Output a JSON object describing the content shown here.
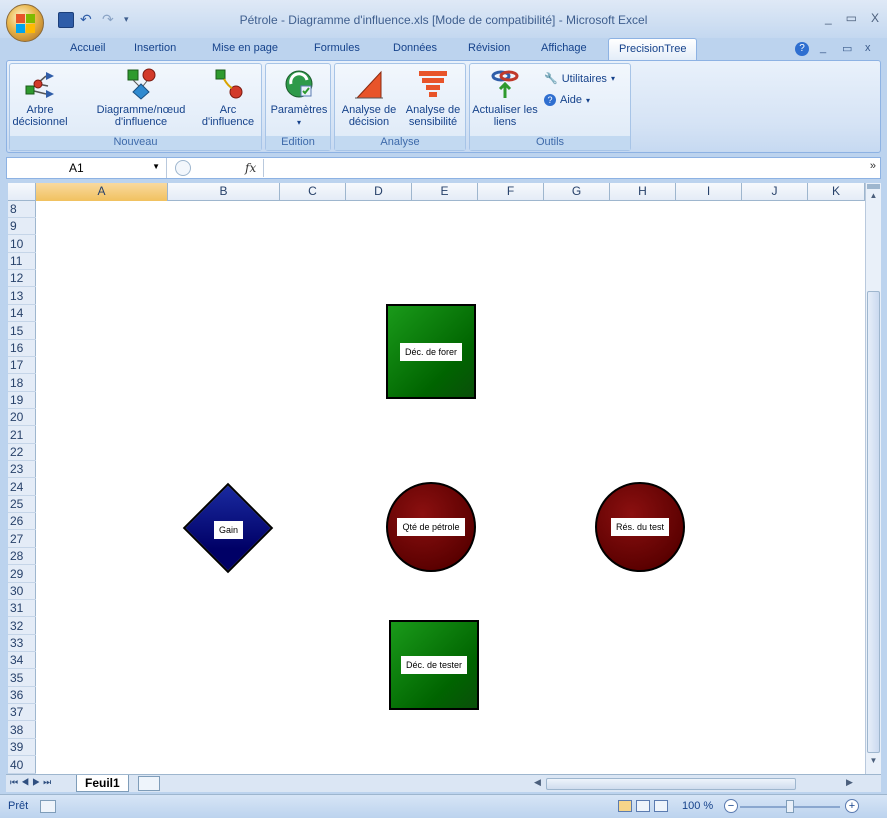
{
  "window": {
    "title": "Pétrole - Diagramme d'influence.xls  [Mode de compatibilité] - Microsoft Excel",
    "controls": [
      "_",
      "▭",
      "X"
    ]
  },
  "tabs": [
    "Accueil",
    "Insertion",
    "Mise en page",
    "Formules",
    "Données",
    "Révision",
    "Affichage",
    "PrecisionTree"
  ],
  "active_tab": "PrecisionTree",
  "ribbon": {
    "groups": {
      "nouveau": "Nouveau",
      "edition": "Edition",
      "analyse": "Analyse",
      "outils": "Outils"
    },
    "buttons": {
      "arbre": "Arbre décisionnel",
      "diagramme": "Diagramme/nœud d'influence",
      "arc": "Arc d'influence",
      "parametres": "Paramètres",
      "analyse_decision": "Analyse de décision",
      "analyse_sensibilite": "Analyse de sensibilité",
      "actualiser": "Actualiser les liens",
      "utilitaires": "Utilitaires",
      "aide": "Aide"
    }
  },
  "formula_bar": {
    "name_box": "A1",
    "fx": "fx",
    "formula": ""
  },
  "columns": [
    "A",
    "B",
    "C",
    "D",
    "E",
    "F",
    "G",
    "H",
    "I",
    "J",
    "K"
  ],
  "rows": [
    "8",
    "9",
    "10",
    "11",
    "12",
    "13",
    "14",
    "15",
    "16",
    "17",
    "18",
    "19",
    "20",
    "21",
    "22",
    "23",
    "24",
    "25",
    "26",
    "27",
    "28",
    "29",
    "30",
    "31",
    "32",
    "33",
    "34",
    "35",
    "36",
    "37",
    "38",
    "39",
    "40"
  ],
  "nodes": {
    "forer": "Déc. de forer",
    "gain": "Gain",
    "petrole": "Qté de pétrole",
    "test": "Rés. du test",
    "tester": "Déc. de tester"
  },
  "sheet_tab": "Feuil1",
  "status": {
    "ready": "Prêt",
    "zoom": "100 %"
  }
}
